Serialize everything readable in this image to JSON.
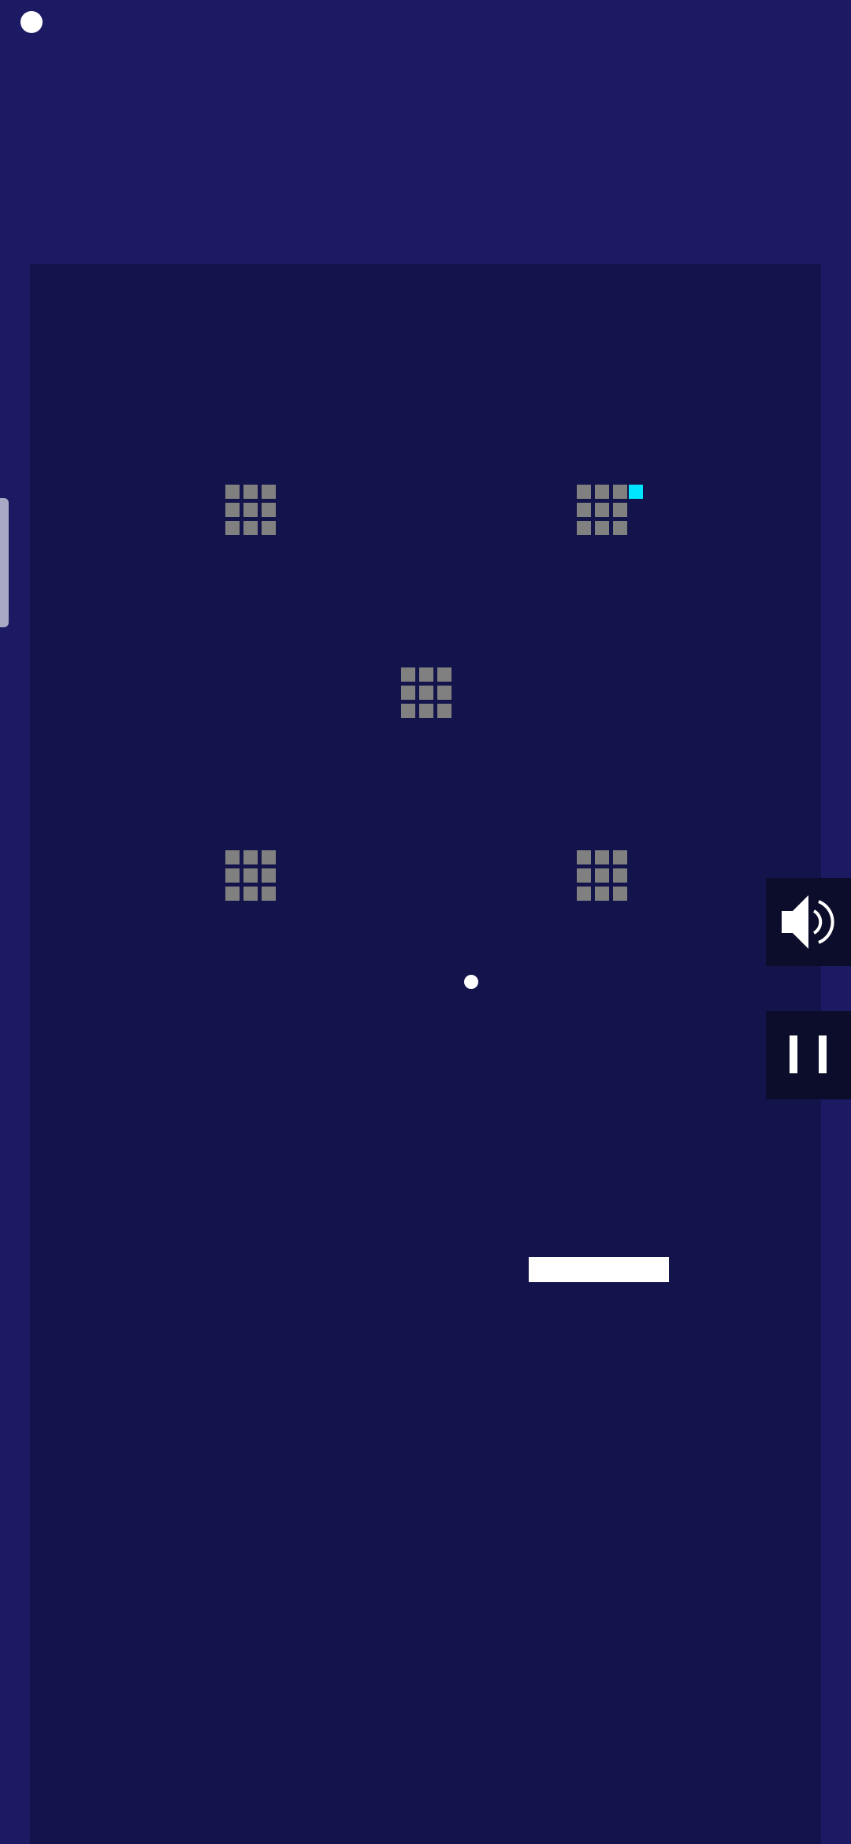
{
  "game": {
    "background_color": "#1b1a63",
    "playfield_color": "#14144c",
    "ball_color": "#ffffff",
    "paddle_color": "#ffffff"
  },
  "brick_clusters": [
    {
      "id": 1,
      "rows": 3,
      "cols": 3,
      "color": "#808080"
    },
    {
      "id": 2,
      "rows": 3,
      "cols": 3,
      "color": "#808080"
    },
    {
      "id": 3,
      "rows": 3,
      "cols": 3,
      "color": "#808080"
    },
    {
      "id": 4,
      "rows": 3,
      "cols": 3,
      "color": "#808080"
    },
    {
      "id": 5,
      "rows": 3,
      "cols": 3,
      "color": "#808080"
    }
  ],
  "special_brick": {
    "color": "#00e5ff"
  },
  "controls": {
    "sound": {
      "icon": "speaker-icon",
      "state": "on"
    },
    "pause": {
      "icon": "pause-icon"
    }
  }
}
